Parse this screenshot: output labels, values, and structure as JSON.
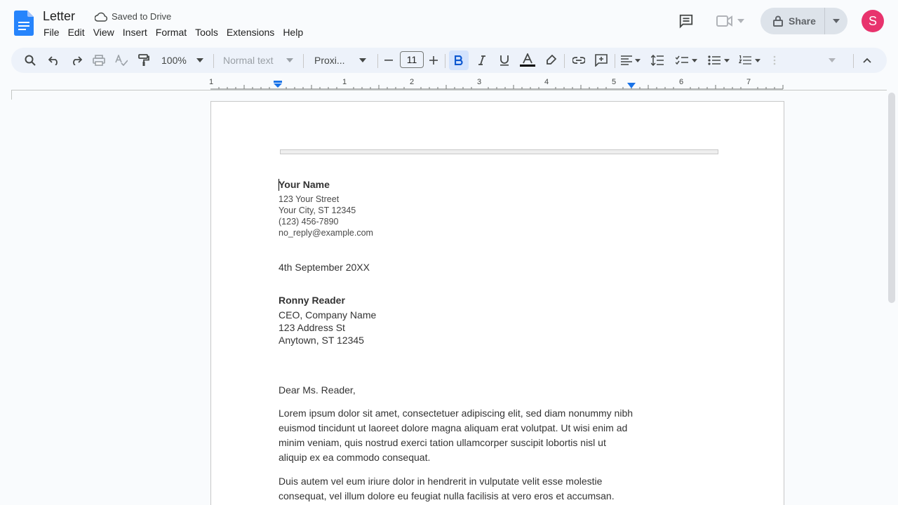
{
  "app": {
    "title": "Letter",
    "save_status": "Saved to Drive",
    "menu": [
      "File",
      "Edit",
      "View",
      "Insert",
      "Format",
      "Tools",
      "Extensions",
      "Help"
    ],
    "share_label": "Share",
    "avatar_letter": "S",
    "colors": {
      "accent": "#1a73e8",
      "avatar": "#e8336d",
      "toolbar_bg": "#edf2fa",
      "active_button": "#d3e3fd"
    }
  },
  "toolbar": {
    "zoom": "100%",
    "style": "Normal text",
    "font": "Proxi...",
    "font_size": "11",
    "icons": [
      "search-icon",
      "undo-icon",
      "redo-icon",
      "print-icon",
      "spellcheck-icon",
      "paint-format-icon",
      "bold-icon",
      "italic-icon",
      "underline-icon",
      "text-color-icon",
      "highlight-icon",
      "link-icon",
      "comment-icon",
      "align-icon",
      "line-spacing-icon",
      "checklist-icon",
      "bullet-list-icon",
      "numbered-list-icon",
      "collapse-icon"
    ]
  },
  "ruler": {
    "labels": [
      "1",
      "1",
      "2",
      "3",
      "4",
      "5",
      "6",
      "7"
    ]
  },
  "document": {
    "sender": {
      "name": "Your Name",
      "street": "123 Your Street",
      "city": "Your City, ST 12345",
      "phone": "(123) 456-7890",
      "email": "no_reply@example.com"
    },
    "date": "4th September 20XX",
    "recipient": {
      "name": "Ronny Reader",
      "title": "CEO, Company Name",
      "street": "123 Address St",
      "city": "Anytown, ST 12345"
    },
    "salutation": "Dear Ms. Reader,",
    "paragraph1": "Lorem ipsum dolor sit amet, consectetuer adipiscing elit, sed diam nonummy nibh euismod tincidunt ut laoreet dolore magna aliquam erat volutpat. Ut wisi enim ad minim veniam, quis nostrud exerci tation ullamcorper suscipit lobortis nisl ut aliquip ex ea commodo consequat.",
    "paragraph2": "Duis autem vel eum iriure dolor in hendrerit in vulputate velit esse molestie consequat, vel illum dolore eu feugiat nulla facilisis at vero eros et accumsan."
  }
}
